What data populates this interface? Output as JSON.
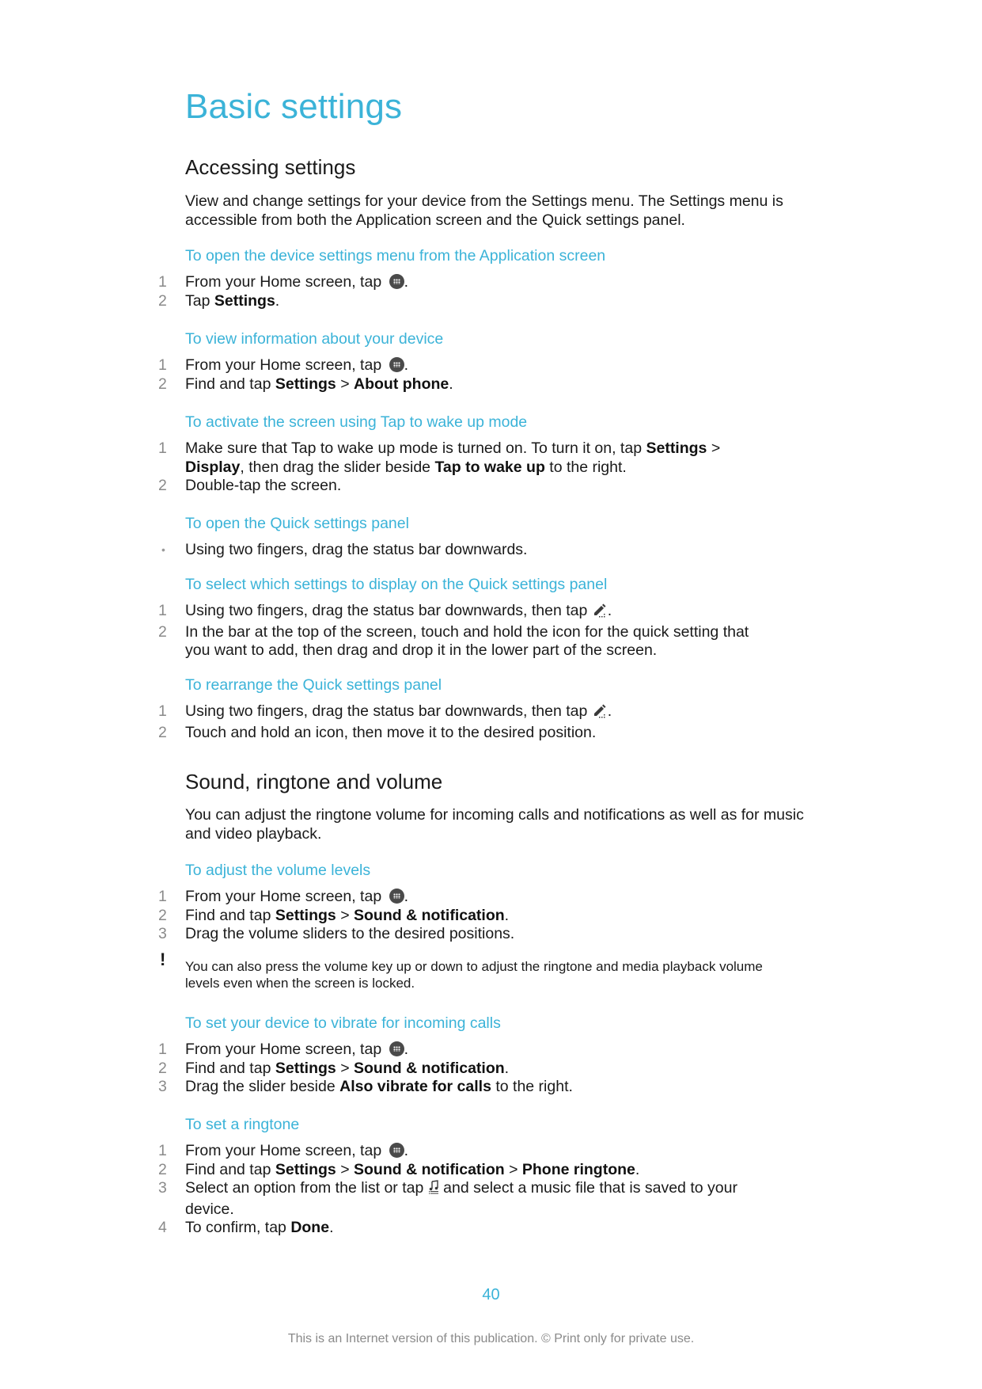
{
  "title": "Basic settings",
  "sections": [
    {
      "heading": "Accessing settings",
      "intro": "View and change settings for your device from the Settings menu. The Settings menu is accessible from both the Application screen and the Quick settings panel.",
      "procedures": [
        {
          "title": "To open the device settings menu from the Application screen",
          "steps": [
            {
              "num": "1",
              "text_before": "From your Home screen, tap ",
              "icon": "apps-icon",
              "text_after": "."
            },
            {
              "num": "2",
              "text_before": "Tap ",
              "bold": "Settings",
              "text_after": "."
            }
          ]
        },
        {
          "title": "To view information about your device",
          "steps": [
            {
              "num": "1",
              "text_before": "From your Home screen, tap ",
              "icon": "apps-icon",
              "text_after": "."
            },
            {
              "num": "2",
              "text_before": "Find and tap ",
              "bold1": "Settings",
              "sep": " > ",
              "bold2": "About phone",
              "text_after": "."
            }
          ]
        },
        {
          "title": "To activate the screen using Tap to wake up mode",
          "steps": [
            {
              "num": "1",
              "text_before": "Make sure that Tap to wake up mode is turned on. To turn it on, tap ",
              "bold1": "Settings",
              "sep": " > ",
              "bold2": "Display",
              "mid": ", then drag the slider beside ",
              "bold3": "Tap to wake up",
              "text_after": " to the right."
            },
            {
              "num": "2",
              "text": "Double-tap the screen."
            }
          ]
        },
        {
          "title": "To open the Quick settings panel",
          "steps": [
            {
              "bullet": "•",
              "text": "Using two fingers, drag the status bar downwards."
            }
          ]
        },
        {
          "title": "To select which settings to display on the Quick settings panel",
          "steps": [
            {
              "num": "1",
              "text_before": "Using two fingers, drag the status bar downwards, then tap ",
              "icon": "edit-icon",
              "text_after": "."
            },
            {
              "num": "2",
              "text": "In the bar at the top of the screen, touch and hold the icon for the quick setting that you want to add, then drag and drop it in the lower part of the screen."
            }
          ]
        },
        {
          "title": "To rearrange the Quick settings panel",
          "steps": [
            {
              "num": "1",
              "text_before": "Using two fingers, drag the status bar downwards, then tap ",
              "icon": "edit-icon",
              "text_after": "."
            },
            {
              "num": "2",
              "text": "Touch and hold an icon, then move it to the desired position."
            }
          ]
        }
      ]
    },
    {
      "heading": "Sound, ringtone and volume",
      "intro": "You can adjust the ringtone volume for incoming calls and notifications as well as for music and video playback.",
      "procedures": [
        {
          "title": "To adjust the volume levels",
          "steps": [
            {
              "num": "1",
              "text_before": "From your Home screen, tap ",
              "icon": "apps-icon",
              "text_after": "."
            },
            {
              "num": "2",
              "text_before": "Find and tap ",
              "bold1": "Settings",
              "sep": " > ",
              "bold2": "Sound & notification",
              "text_after": "."
            },
            {
              "num": "3",
              "text": "Drag the volume sliders to the desired positions."
            }
          ],
          "note": {
            "icon": "!",
            "text": "You can also press the volume key up or down to adjust the ringtone and media playback volume levels even when the screen is locked."
          }
        },
        {
          "title": "To set your device to vibrate for incoming calls",
          "steps": [
            {
              "num": "1",
              "text_before": "From your Home screen, tap ",
              "icon": "apps-icon",
              "text_after": "."
            },
            {
              "num": "2",
              "text_before": "Find and tap ",
              "bold1": "Settings",
              "sep": " > ",
              "bold2": "Sound & notification",
              "text_after": "."
            },
            {
              "num": "3",
              "text_before": "Drag the slider beside ",
              "bold": "Also vibrate for calls",
              "text_after": " to the right."
            }
          ]
        },
        {
          "title": "To set a ringtone",
          "steps": [
            {
              "num": "1",
              "text_before": "From your Home screen, tap ",
              "icon": "apps-icon",
              "text_after": "."
            },
            {
              "num": "2",
              "text_before": "Find and tap ",
              "bold1": "Settings",
              "sep": " > ",
              "bold2": "Sound & notification",
              "sep2": " > ",
              "bold3": "Phone ringtone",
              "text_after": "."
            },
            {
              "num": "3",
              "text_before": "Select an option from the list or tap ",
              "icon": "music-file-icon",
              "text_after": " and select a music file that is saved to your device."
            },
            {
              "num": "4",
              "text_before": "To confirm, tap ",
              "bold": "Done",
              "text_after": "."
            }
          ]
        }
      ]
    }
  ],
  "page_number": "40",
  "footer": "This is an Internet version of this publication. © Print only for private use.",
  "colors": {
    "accent": "#3bb3d8",
    "text": "#1a1a1a",
    "muted": "#8a8a8a"
  }
}
